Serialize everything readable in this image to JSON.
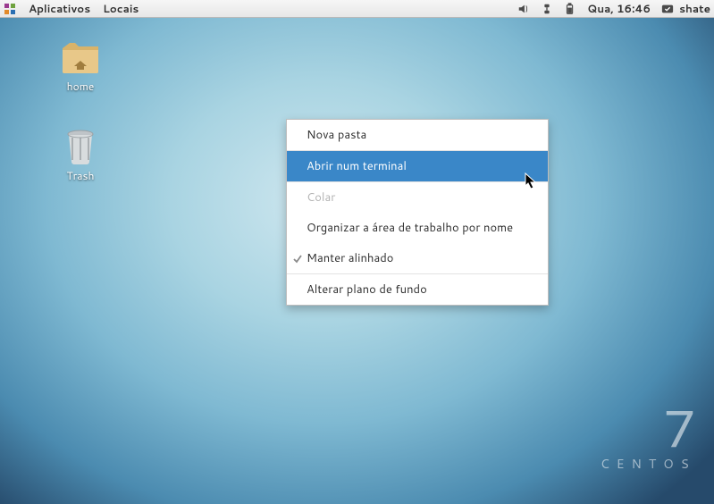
{
  "topbar": {
    "menus": {
      "apps": "Aplicativos",
      "places": "Locais"
    },
    "clock": "Qua, 16:46",
    "user": "shate"
  },
  "desktop": {
    "icons": {
      "home": {
        "label": "home"
      },
      "trash": {
        "label": "Trash"
      }
    }
  },
  "context_menu": {
    "new_folder": "Nova pasta",
    "open_terminal": "Abrir num terminal",
    "paste": "Colar",
    "organize": "Organizar a área de trabalho por nome",
    "keep_aligned": "Manter alinhado",
    "change_background": "Alterar plano de fundo"
  },
  "brand": {
    "version": "7",
    "name": "CENTOS"
  }
}
